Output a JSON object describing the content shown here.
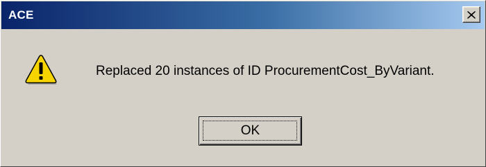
{
  "window": {
    "title": "ACE",
    "close_icon": "close-icon"
  },
  "content": {
    "icon": "warning-icon",
    "message": "Replaced 20 instances of ID ProcurementCost_ByVariant."
  },
  "buttons": {
    "ok_label": "OK"
  },
  "colors": {
    "titlebar_start": "#0a246a",
    "titlebar_end": "#a6caf0",
    "dialog_bg": "#d4d0c8",
    "warning_yellow": "#f5d400"
  }
}
